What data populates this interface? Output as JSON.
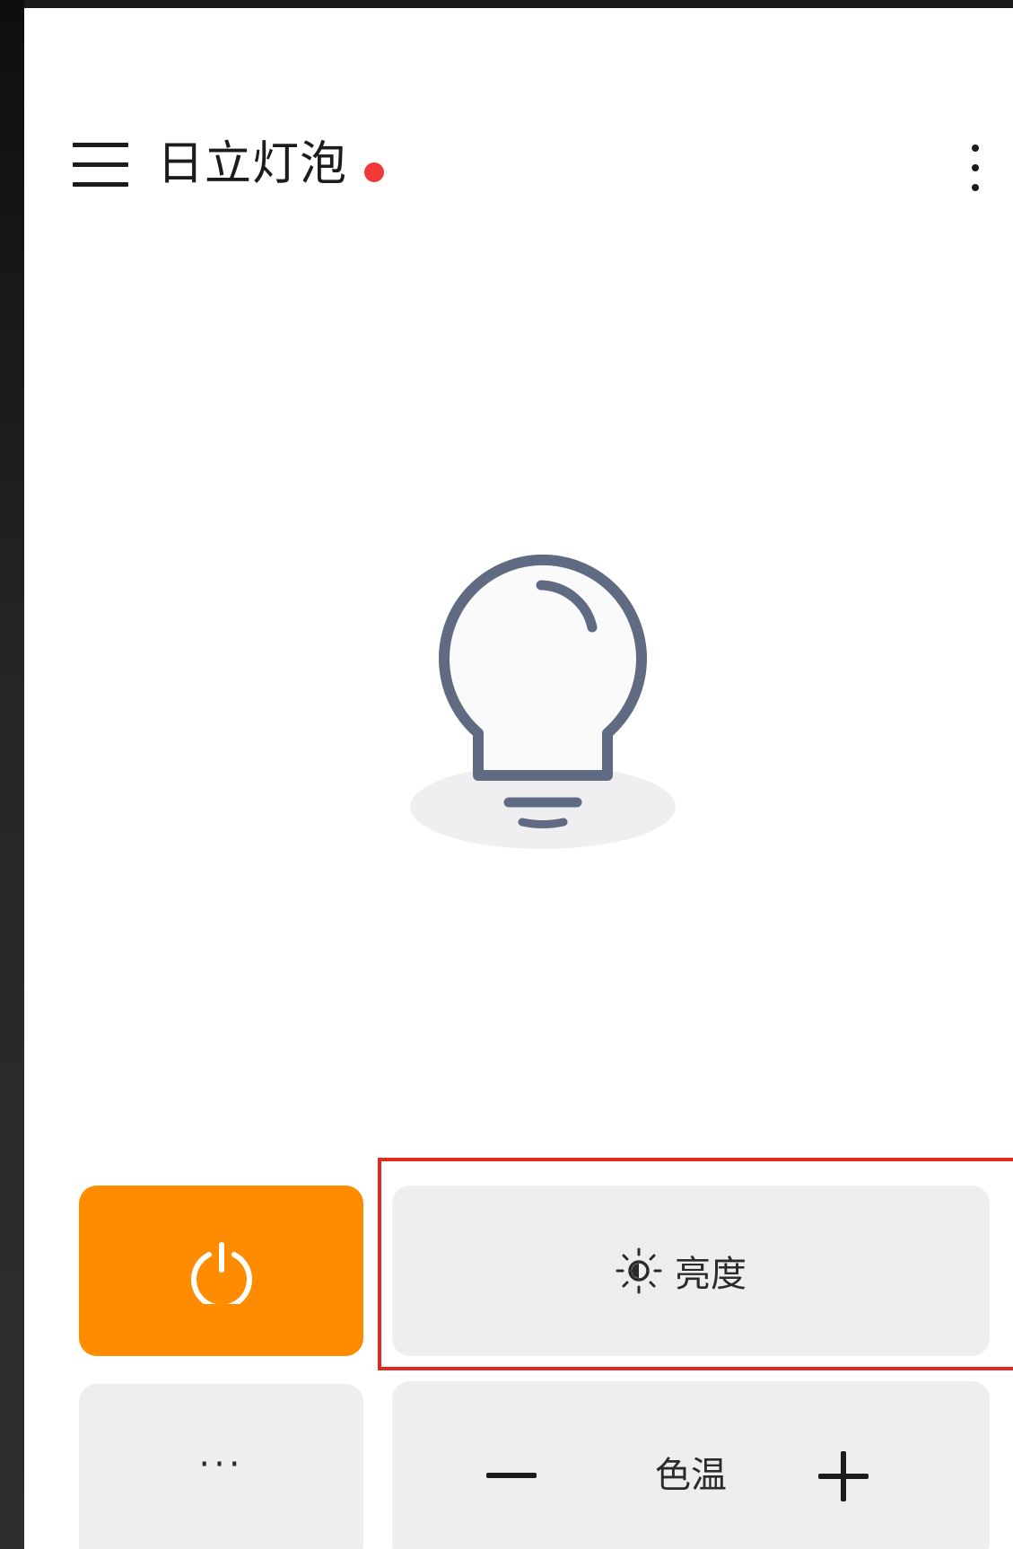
{
  "app_bar": {
    "title": "日立灯泡",
    "status_dot_color": "#f03a3a",
    "menu_icon": "hamburger-menu-icon",
    "overflow_icon": "more-vertical-icon"
  },
  "device": {
    "illustration_icon": "light-bulb-icon",
    "state": "off"
  },
  "controls": {
    "power": {
      "icon": "power-icon",
      "color": "#ff8c00"
    },
    "brightness": {
      "icon": "brightness-sun-icon",
      "label": "亮度"
    },
    "more": {
      "label": "···"
    },
    "color_temperature": {
      "label": "色温",
      "decrease_icon": "minus-icon",
      "increase_icon": "plus-icon"
    }
  },
  "highlight_color": "#e12a1f"
}
